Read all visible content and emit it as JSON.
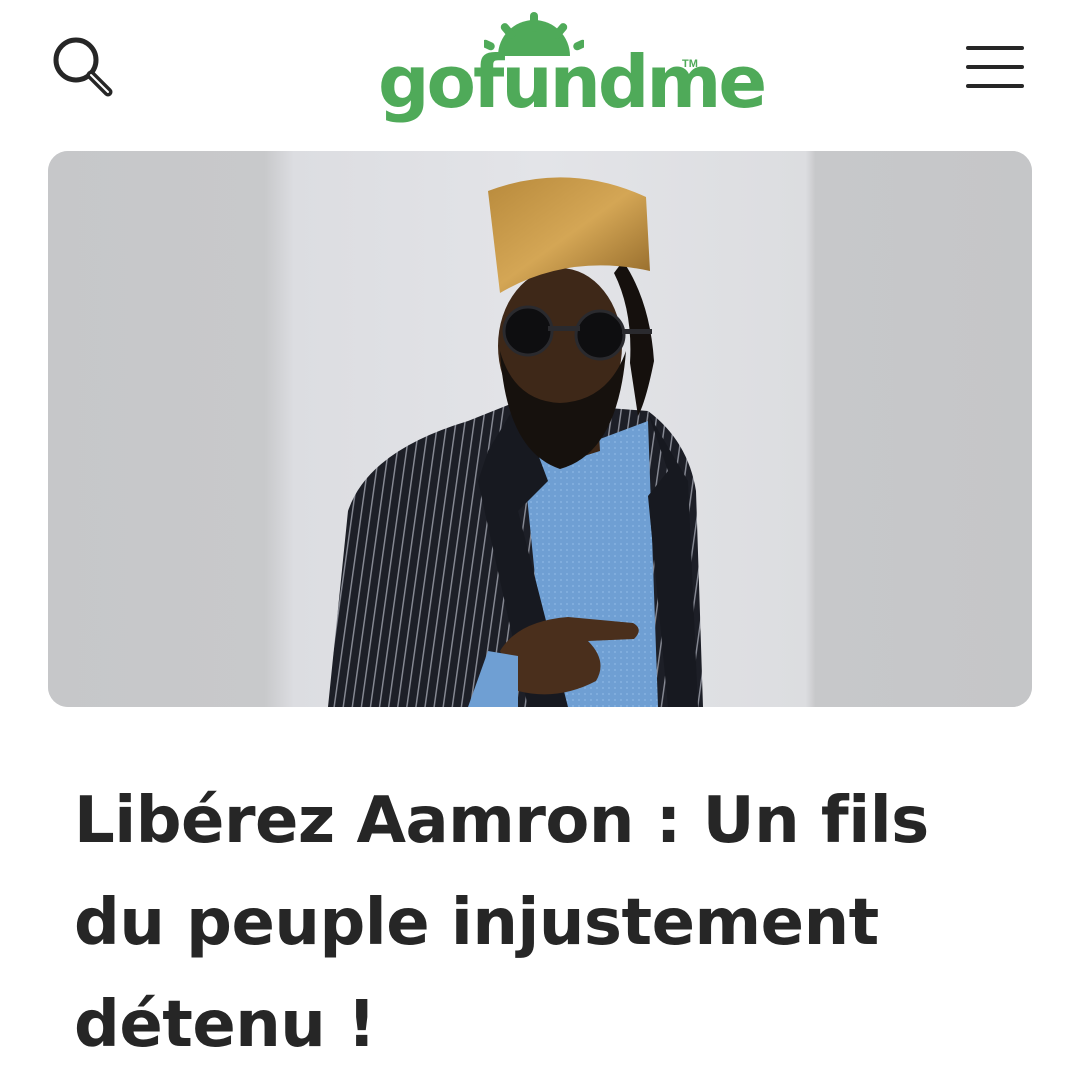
{
  "brand": {
    "name": "gofundme",
    "trademark": "TM",
    "color": "#4faa59"
  },
  "header": {
    "search_icon": "search-icon",
    "menu_icon": "hamburger-menu-icon"
  },
  "campaign": {
    "title": "Libérez Aamron : Un fils du peuple injustement détenu !",
    "image_subject": "portrait-photo"
  },
  "colors": {
    "text": "#262626",
    "icon": "#262626",
    "image_background": "#c9cacc"
  }
}
